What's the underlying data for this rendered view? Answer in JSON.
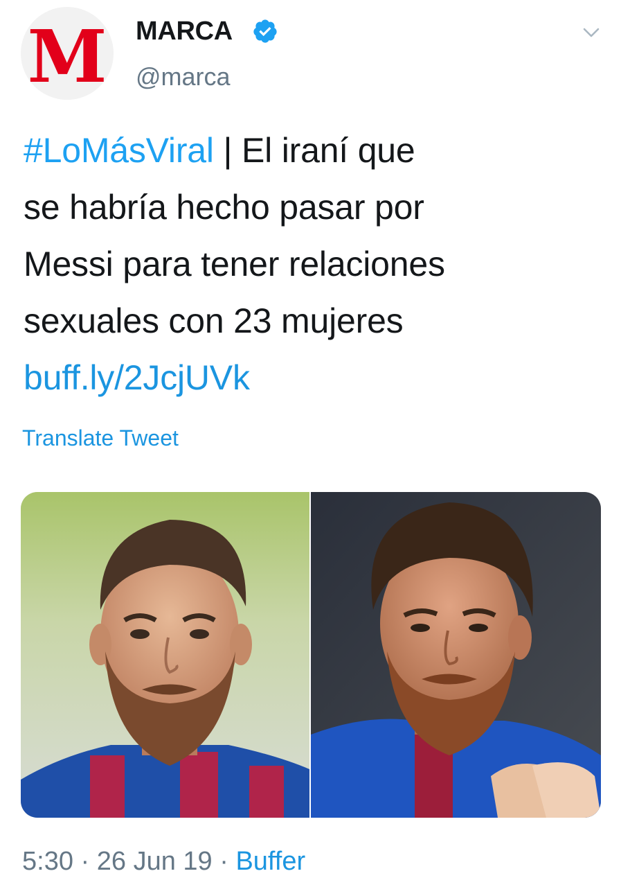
{
  "account": {
    "name": "MARCA",
    "handle": "@marca",
    "avatar_letter": "M",
    "avatar_color": "#e2001a",
    "verified_icon": "verified-badge-icon",
    "verified_color": "#1da1f2"
  },
  "tweet": {
    "hashtag": "#LoMásViral",
    "line1_rest": " | El iraní que",
    "line2": "se habría hecho pasar por",
    "line3": "Messi para tener relaciones",
    "line4": "sexuales con 23 mujeres",
    "link": "buff.ly/2JcjUVk"
  },
  "translate_label": "Translate Tweet",
  "media": {
    "left_image": "man-with-beard-in-striped-jersey",
    "right_image": "footballer-with-beard-adjusting-jersey"
  },
  "meta": {
    "time": "5:30",
    "sep1": " · ",
    "date": "26 Jun 19",
    "sep2": " · ",
    "source": "Buffer"
  },
  "icons": {
    "caret": "chevron-down-icon"
  }
}
